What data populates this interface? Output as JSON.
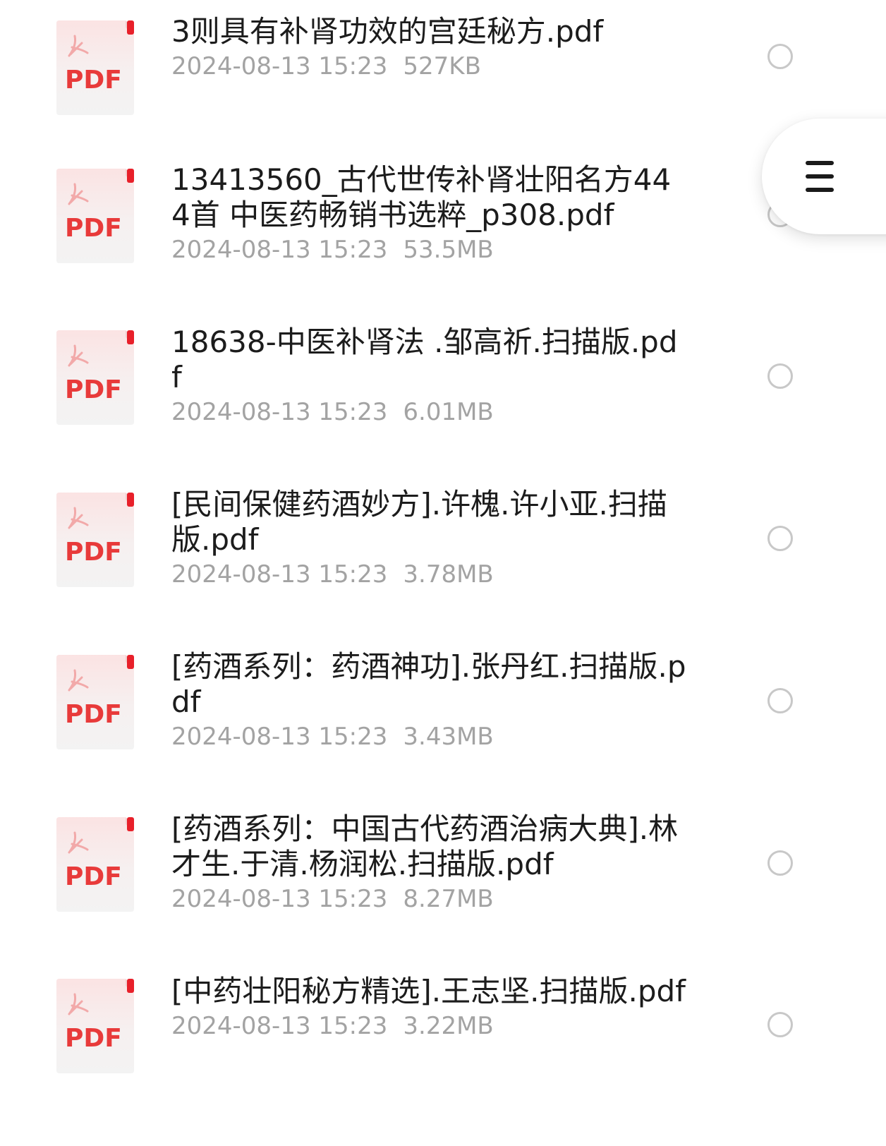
{
  "files": [
    {
      "name": "3则具有补肾功效的宫廷秘方.pdf",
      "date": "2024-08-13 15:23",
      "size": "527KB",
      "icon": "pdf-file-icon",
      "icon_label": "PDF"
    },
    {
      "name": "13413560_古代世传补肾壮阳名方444首  中医药畅销书选粹_p308.pdf",
      "date": "2024-08-13 15:23",
      "size": "53.5MB",
      "icon": "pdf-file-icon",
      "icon_label": "PDF"
    },
    {
      "name": "18638-中医补肾法 .邹高祈.扫描版.pdf",
      "date": "2024-08-13 15:23",
      "size": "6.01MB",
      "icon": "pdf-file-icon",
      "icon_label": "PDF"
    },
    {
      "name": "[民间保健药酒妙方].许槐.许小亚.扫描版.pdf",
      "date": "2024-08-13 15:23",
      "size": "3.78MB",
      "icon": "pdf-file-icon",
      "icon_label": "PDF"
    },
    {
      "name": "[药酒系列：药酒神功].张丹红.扫描版.pdf",
      "date": "2024-08-13 15:23",
      "size": "3.43MB",
      "icon": "pdf-file-icon",
      "icon_label": "PDF"
    },
    {
      "name": "[药酒系列：中国古代药酒治病大典].林才生.于清.杨润松.扫描版.pdf",
      "date": "2024-08-13 15:23",
      "size": "8.27MB",
      "icon": "pdf-file-icon",
      "icon_label": "PDF"
    },
    {
      "name": "[中药壮阳秘方精选].王志坚.扫描版.pdf",
      "date": "2024-08-13 15:23",
      "size": "3.22MB",
      "icon": "pdf-file-icon",
      "icon_label": "PDF"
    }
  ],
  "floating_menu": {
    "icon": "hamburger-menu-icon"
  },
  "colors": {
    "pdf_red": "#e83a3a",
    "pdf_corner": "#e8202a",
    "name_text": "#1c1c1c",
    "meta_text": "#a3a3a3",
    "radio_border": "#c8c8c8"
  }
}
